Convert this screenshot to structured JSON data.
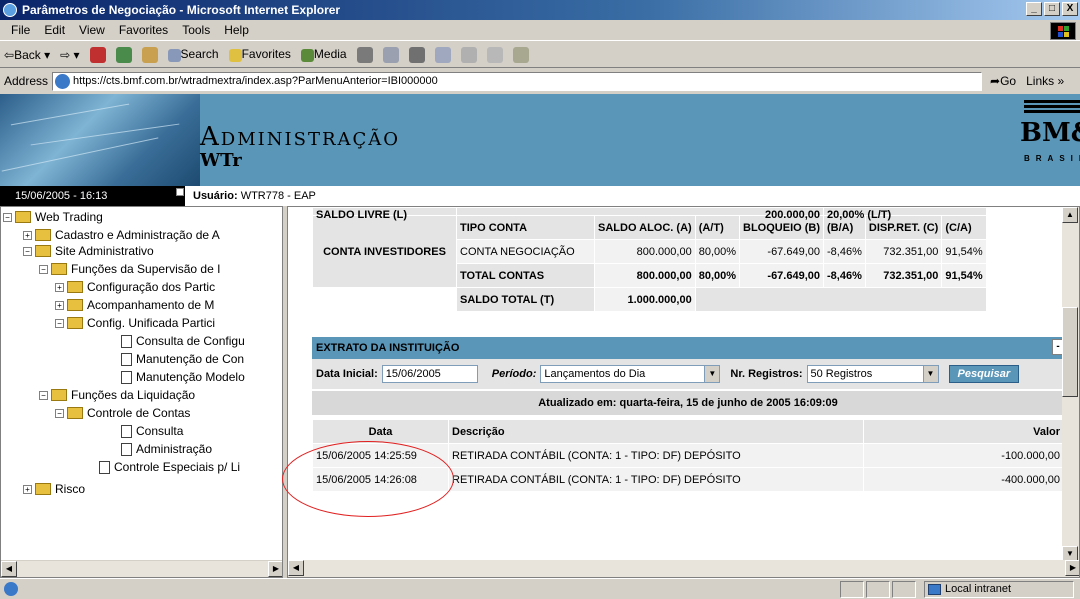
{
  "window": {
    "title": "Parâmetros de Negociação - Microsoft Internet Explorer",
    "controls": [
      "_",
      "□",
      "X"
    ]
  },
  "menu": [
    "File",
    "Edit",
    "View",
    "Favorites",
    "Tools",
    "Help"
  ],
  "toolbar": {
    "back": "Back",
    "search": "Search",
    "favorites": "Favorites",
    "media": "Media"
  },
  "address": {
    "label": "Address",
    "url": "https://cts.bmf.com.br/wtradmextra/index.asp?ParMenuAnterior=IBI000000",
    "go": "Go",
    "links": "Links »"
  },
  "header": {
    "title": "Administração",
    "subtitle": "WTr",
    "logo_name": "BM&F",
    "logo_sub": "BRASIL"
  },
  "infobar": {
    "datetime": "15/06/2005 - 16:13",
    "user_label": "Usuário:",
    "user_value": "WTR778 - EAP"
  },
  "tree": {
    "root": "Web Trading",
    "items": [
      "Cadastro e Administração de A",
      "Site Administrativo",
      "Funções da Supervisão de I",
      "Configuração dos Partic",
      "Acompanhamento de M",
      "Config. Unificada Partici",
      "Consulta de Configu",
      "Manutenção de Con",
      "Manutenção Modelo",
      "Funções da Liquidação",
      "Controle de Contas",
      "Consulta",
      "Administração",
      "Controle Especiais p/ Li",
      "Risco"
    ]
  },
  "saldo": {
    "top_label": "SALDO LIVRE (L)",
    "top_value": "200.000,00",
    "top_pct": "20,00% (L/T)",
    "section_label": "CONTA INVESTIDORES",
    "headers": [
      "TIPO CONTA",
      "SALDO ALOC. (A)",
      "(A/T)",
      "BLOQUEIO (B)",
      "(B/A)",
      "DISP.RET. (C)",
      "(C/A)"
    ],
    "rows": [
      [
        "CONTA NEGOCIAÇÃO",
        "800.000,00",
        "80,00%",
        "-67.649,00",
        "-8,46%",
        "732.351,00",
        "91,54%"
      ],
      [
        "TOTAL CONTAS",
        "800.000,00",
        "80,00%",
        "-67.649,00",
        "-8,46%",
        "732.351,00",
        "91,54%"
      ]
    ],
    "total_label": "SALDO TOTAL (T)",
    "total_value": "1.000.000,00"
  },
  "extrato": {
    "title": "EXTRATO DA INSTITUIÇÃO",
    "min": "-",
    "data_inicial_label": "Data Inicial:",
    "data_inicial": "15/06/2005",
    "periodo_label": "Período:",
    "periodo": "Lançamentos do Dia",
    "registros_label": "Nr. Registros:",
    "registros": "50 Registros",
    "pesquisar": "Pesquisar",
    "updated": "Atualizado em: quarta-feira, 15 de junho de 2005 16:09:09",
    "columns": [
      "Data",
      "Descrição",
      "Valor"
    ],
    "rows": [
      {
        "data": "15/06/2005 14:25:59",
        "desc": "RETIRADA CONTÁBIL (CONTA: 1 - TIPO: DF) DEPÓSITO",
        "valor": "-100.000,00"
      },
      {
        "data": "15/06/2005 14:26:08",
        "desc": "RETIRADA CONTÁBIL (CONTA: 1 - TIPO: DF) DEPÓSITO",
        "valor": "-400.000,00"
      }
    ]
  },
  "status": {
    "zone": "Local intranet"
  }
}
